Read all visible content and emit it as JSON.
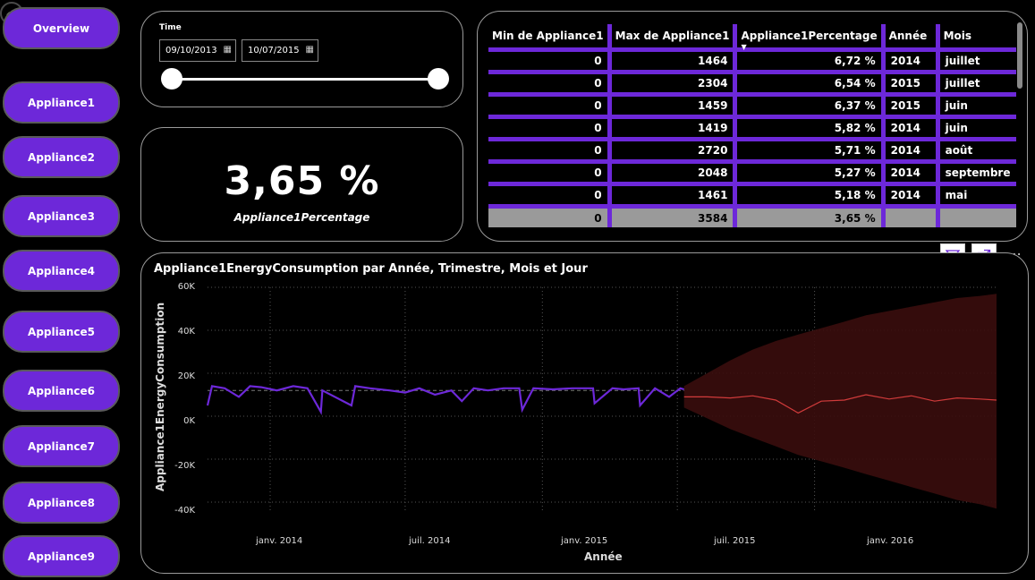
{
  "nav": {
    "overview": "Overview",
    "appliances": [
      "Appliance1",
      "Appliance2",
      "Appliance3",
      "Appliance4",
      "Appliance5",
      "Appliance6",
      "Appliance7",
      "Appliance8",
      "Appliance9"
    ]
  },
  "slicer": {
    "title": "Time",
    "start": "09/10/2013",
    "end": "10/07/2015",
    "position": [
      0,
      1
    ]
  },
  "kpi": {
    "value": "3,65 %",
    "label": "Appliance1Percentage"
  },
  "table": {
    "headers": [
      "Min de Appliance1",
      "Max de Appliance1",
      "Appliance1Percentage",
      "Année",
      "Mois"
    ],
    "rows": [
      [
        "0",
        "1464",
        "6,72 %",
        "2014",
        "juillet"
      ],
      [
        "0",
        "2304",
        "6,54 %",
        "2015",
        "juillet"
      ],
      [
        "0",
        "1459",
        "6,37 %",
        "2015",
        "juin"
      ],
      [
        "0",
        "1419",
        "5,82 %",
        "2014",
        "juin"
      ],
      [
        "0",
        "2720",
        "5,71 %",
        "2014",
        "août"
      ],
      [
        "0",
        "2048",
        "5,27 %",
        "2014",
        "septembre"
      ],
      [
        "0",
        "1461",
        "5,18 %",
        "2014",
        "mai"
      ]
    ],
    "total": [
      "0",
      "3584",
      "3,65 %",
      "",
      ""
    ]
  },
  "icons": [
    "back-arrow-icon",
    "calendar-icon",
    "filter-icon",
    "focus-mode-icon",
    "more-options-icon",
    "sort-desc-icon"
  ],
  "colors": {
    "accent": "#6d28d9",
    "forecast": "#d13b3b",
    "forecast_band": "#3a0d0d"
  },
  "chart": {
    "title": "Appliance1EnergyConsumption par Année, Trimestre, Mois et Jour",
    "xlabel": "Année",
    "ylabel": "Appliance1EnergyConsumption",
    "yticks": [
      "60K",
      "40K",
      "20K",
      "0K",
      "-20K",
      "-40K"
    ],
    "xticks": [
      "janv. 2014",
      "juil. 2014",
      "janv. 2015",
      "juil. 2015",
      "janv. 2016"
    ]
  },
  "chart_data": {
    "type": "line",
    "ylim": [
      -45000,
      60000
    ],
    "xlim": [
      "2013-10-09",
      "2016-09-01"
    ],
    "grid": true,
    "series": [
      {
        "kind": "actual",
        "x": [
          "2013-10-09",
          "2013-10-15",
          "2013-11-01",
          "2013-11-20",
          "2013-12-05",
          "2013-12-20",
          "2014-01-10",
          "2014-02-01",
          "2014-02-20",
          "2014-03-10",
          "2014-03-12",
          "2014-04-20",
          "2014-04-25",
          "2014-05-15",
          "2014-06-10",
          "2014-07-01",
          "2014-07-20",
          "2014-08-10",
          "2014-09-01",
          "2014-09-15",
          "2014-10-01",
          "2014-10-20",
          "2014-11-10",
          "2014-12-01",
          "2014-12-05",
          "2014-12-20",
          "2015-01-15",
          "2015-02-10",
          "2015-03-10",
          "2015-03-12",
          "2015-04-05",
          "2015-04-20",
          "2015-05-10",
          "2015-05-12",
          "2015-06-01",
          "2015-06-20",
          "2015-07-05",
          "2015-07-10"
        ],
        "values": [
          5000,
          14000,
          13000,
          9000,
          14000,
          13500,
          12000,
          14000,
          13000,
          2000,
          12000,
          5000,
          14000,
          13000,
          12000,
          11000,
          13000,
          10000,
          12000,
          7000,
          13000,
          12000,
          13000,
          13000,
          3000,
          13000,
          12500,
          13000,
          13000,
          6000,
          13000,
          12500,
          13000,
          5000,
          13000,
          9000,
          13000,
          12500
        ]
      },
      {
        "kind": "forecast",
        "x": [
          "2015-07-10",
          "2015-08-10",
          "2015-09-10",
          "2015-10-10",
          "2015-11-10",
          "2015-12-10",
          "2016-01-10",
          "2016-02-10",
          "2016-03-10",
          "2016-04-10",
          "2016-05-10",
          "2016-06-10",
          "2016-07-10",
          "2016-08-10",
          "2016-09-01"
        ],
        "values": [
          9000,
          9000,
          8500,
          9500,
          7500,
          1500,
          7000,
          7500,
          10000,
          8000,
          9500,
          7000,
          8500,
          8000,
          7500
        ],
        "upper": [
          14000,
          20000,
          26000,
          31000,
          35000,
          38000,
          41000,
          44000,
          47000,
          49000,
          51000,
          53000,
          55000,
          56000,
          57000
        ],
        "lower": [
          4000,
          -1000,
          -6000,
          -10000,
          -14000,
          -18000,
          -21000,
          -24000,
          -27000,
          -30000,
          -33000,
          -36000,
          -39000,
          -41000,
          -43000
        ]
      }
    ],
    "reference_line": 12000
  }
}
